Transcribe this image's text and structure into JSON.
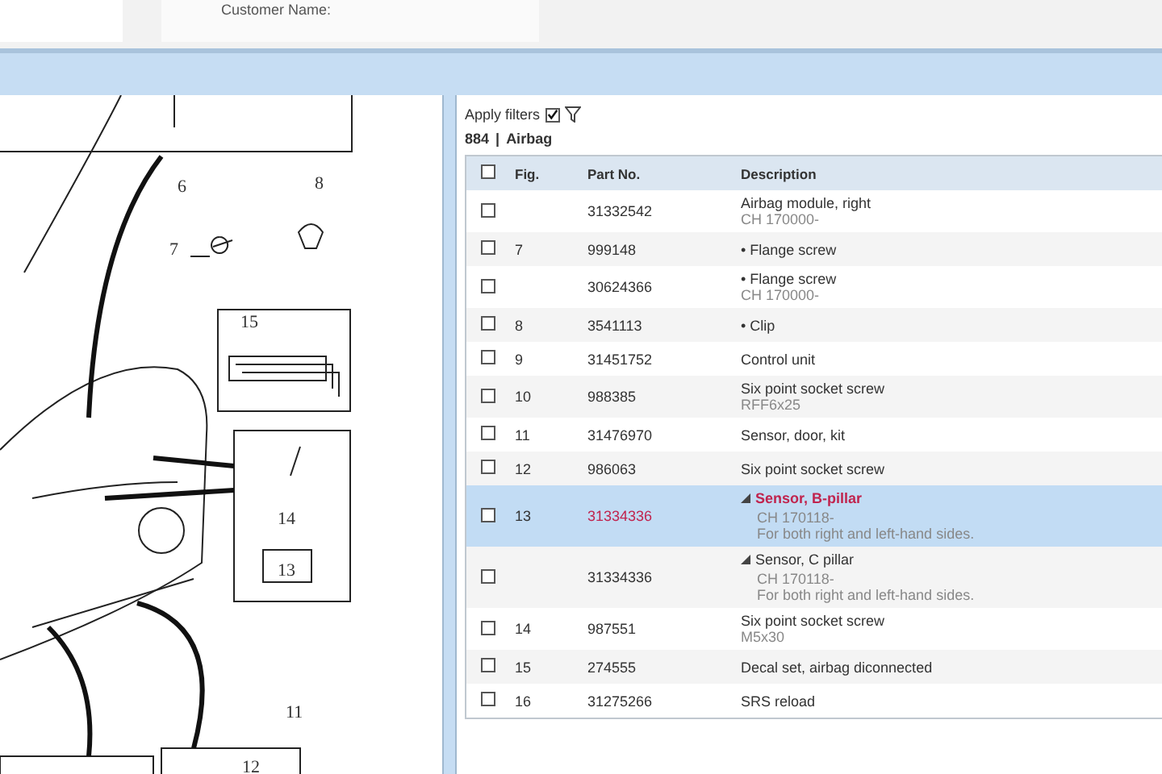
{
  "header": {
    "customer_label": "Customer Name:"
  },
  "diagram": {
    "callouts": [
      "6",
      "7",
      "8",
      "15",
      "14",
      "13",
      "11",
      "12"
    ]
  },
  "filters": {
    "label": "Apply filters",
    "checked": true
  },
  "group": {
    "number": "884",
    "separator": "|",
    "name": "Airbag"
  },
  "table": {
    "columns": [
      "Fig.",
      "Part No.",
      "Description"
    ],
    "header_checked": false,
    "rows": [
      {
        "kind": "item",
        "fig": "",
        "part_no": "31332542",
        "description": "Airbag module, right",
        "notes": [
          "CH 170000-"
        ],
        "checked": false,
        "selected": false
      },
      {
        "kind": "item",
        "fig": "7",
        "part_no": "999148",
        "description": "• Flange screw",
        "notes": [],
        "checked": false,
        "selected": false
      },
      {
        "kind": "item",
        "fig": "",
        "part_no": "30624366",
        "description": "• Flange screw",
        "notes": [
          "CH 170000-"
        ],
        "checked": false,
        "selected": false
      },
      {
        "kind": "item",
        "fig": "8",
        "part_no": "3541113",
        "description": "• Clip",
        "notes": [],
        "checked": false,
        "selected": false
      },
      {
        "kind": "item",
        "fig": "9",
        "part_no": "31451752",
        "description": "Control unit",
        "notes": [],
        "checked": false,
        "selected": false
      },
      {
        "kind": "item",
        "fig": "10",
        "part_no": "988385",
        "description": "Six point socket screw",
        "notes": [
          "RFF6x25"
        ],
        "checked": false,
        "selected": false
      },
      {
        "kind": "item",
        "fig": "11",
        "part_no": "31476970",
        "description": "Sensor, door, kit",
        "notes": [],
        "checked": false,
        "selected": false
      },
      {
        "kind": "item",
        "fig": "12",
        "part_no": "986063",
        "description": "Six point socket screw",
        "notes": [],
        "checked": false,
        "selected": false
      },
      {
        "kind": "group",
        "fig": "13",
        "part_no": "31334336",
        "description": "Sensor, B-pillar",
        "notes": [
          "CH 170118-",
          "For both right and left-hand sides."
        ],
        "checked": false,
        "selected": true
      },
      {
        "kind": "group",
        "fig": "",
        "part_no": "31334336",
        "description": "Sensor, C pillar",
        "notes": [
          "CH 170118-",
          "For both right and left-hand sides."
        ],
        "checked": false,
        "selected": false
      },
      {
        "kind": "item",
        "fig": "14",
        "part_no": "987551",
        "description": "Six point socket screw",
        "notes": [
          "M5x30"
        ],
        "checked": false,
        "selected": false
      },
      {
        "kind": "item",
        "fig": "15",
        "part_no": "274555",
        "description": "Decal set, airbag diconnected",
        "notes": [],
        "checked": false,
        "selected": false
      },
      {
        "kind": "item",
        "fig": "16",
        "part_no": "31275266",
        "description": "SRS reload",
        "notes": [],
        "checked": false,
        "selected": false
      }
    ]
  }
}
